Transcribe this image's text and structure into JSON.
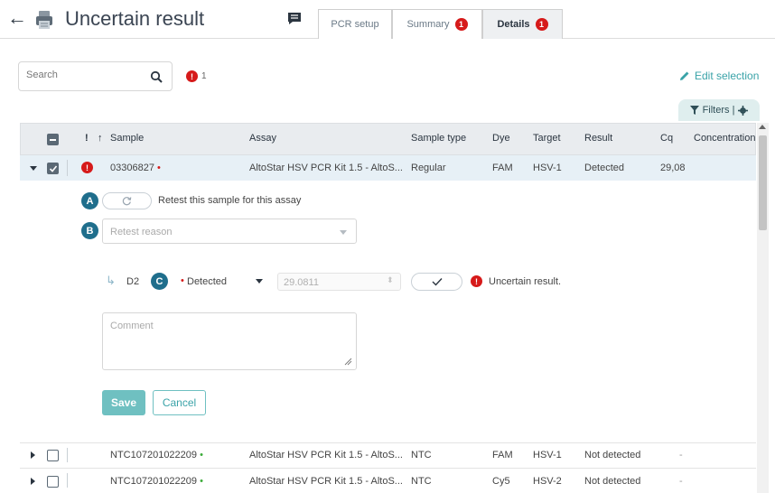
{
  "header": {
    "title": "Uncertain result",
    "tabs": [
      {
        "label": "PCR setup",
        "badge": ""
      },
      {
        "label": "Summary",
        "badge": "1"
      },
      {
        "label": "Details",
        "badge": "1"
      }
    ]
  },
  "toolbar": {
    "search_placeholder": "Search",
    "error_badge": "!",
    "error_count": "1",
    "edit_selection": "Edit selection",
    "filters_label": "Filters |"
  },
  "table": {
    "columns": [
      "!",
      "Sample",
      "Assay",
      "Sample type",
      "Dye",
      "Target",
      "Result",
      "Cq",
      "Concentration"
    ],
    "sort_indicator": "↑",
    "rows": [
      {
        "sample": "03306827",
        "assay": "AltoStar HSV PCR Kit 1.5 - AltoS...",
        "sample_type": "Regular",
        "dye": "FAM",
        "target": "HSV-1",
        "result": "Detected",
        "cq": "29,08",
        "concentration": ""
      },
      {
        "sample": "NTC107201022209",
        "assay": "AltoStar HSV PCR Kit 1.5 - AltoS...",
        "sample_type": "NTC",
        "dye": "FAM",
        "target": "HSV-1",
        "result": "Not detected",
        "cq": "-",
        "concentration": ""
      },
      {
        "sample": "NTC107201022209",
        "assay": "AltoStar HSV PCR Kit 1.5 - AltoS...",
        "sample_type": "NTC",
        "dye": "Cy5",
        "target": "HSV-2",
        "result": "Not detected",
        "cq": "-",
        "concentration": ""
      }
    ]
  },
  "detail": {
    "label_a": "A",
    "label_b": "B",
    "label_c": "C",
    "retest_text": "Retest this sample for this assay",
    "retest_reason_placeholder": "Retest reason",
    "well": "D2",
    "result_select": "Detected",
    "cq_value": "29.0811",
    "status_icon": "!",
    "status_text": "Uncertain result.",
    "comment_placeholder": "Comment",
    "save_label": "Save",
    "cancel_label": "Cancel"
  },
  "colors": {
    "accent": "#3aa3a8",
    "error": "#d61a1a",
    "label_circle": "#1f6e8c",
    "row_selected": "#e7f0f6"
  }
}
